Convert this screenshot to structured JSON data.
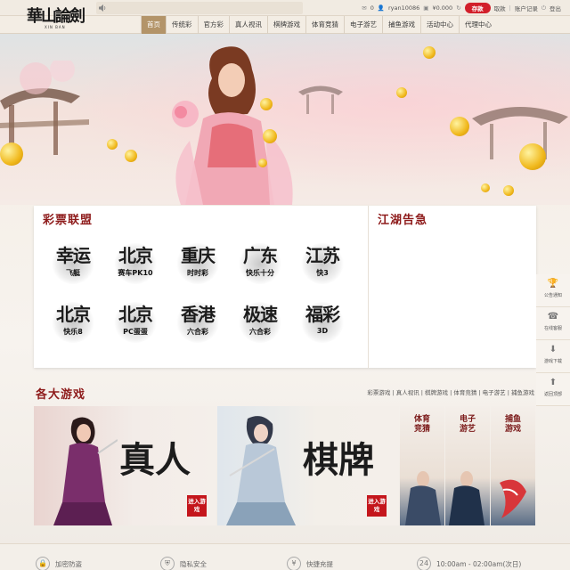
{
  "logo": {
    "text": "華山論劍",
    "sub": "XIN BAN"
  },
  "topbar": {
    "username": "ryan10086",
    "mail_count": "0",
    "balance": "¥0.000",
    "deposit": "存款",
    "withdraw": "取款",
    "account_records": "账户记录",
    "logout": "登出"
  },
  "nav": [
    "首页",
    "传统彩",
    "官方彩",
    "真人视讯",
    "棋牌游戏",
    "体育竞猜",
    "电子游艺",
    "捕鱼游戏",
    "活动中心",
    "代理中心"
  ],
  "lottery": {
    "title": "彩票联盟",
    "items": [
      {
        "big": "幸运",
        "small": "飞艇"
      },
      {
        "big": "北京",
        "small": "赛车PK10"
      },
      {
        "big": "重庆",
        "small": "时时彩"
      },
      {
        "big": "广东",
        "small": "快乐十分"
      },
      {
        "big": "江苏",
        "small": "快3"
      },
      {
        "big": "北京",
        "small": "快乐8"
      },
      {
        "big": "北京",
        "small": "PC蛋蛋"
      },
      {
        "big": "香港",
        "small": "六合彩"
      },
      {
        "big": "极速",
        "small": "六合彩"
      },
      {
        "big": "福彩",
        "small": "3D"
      }
    ]
  },
  "notice": {
    "title": "江湖告急"
  },
  "sidebar": [
    {
      "icon": "trophy-icon",
      "glyph": "🏆",
      "label": "公告通知"
    },
    {
      "icon": "headset-icon",
      "glyph": "☎",
      "label": "在线客服"
    },
    {
      "icon": "download-icon",
      "glyph": "⬇",
      "label": "游戏下载"
    },
    {
      "icon": "back-top-icon",
      "glyph": "⬆",
      "label": "返回顶部"
    }
  ],
  "games": {
    "title": "各大游戏",
    "links": "彩票游戏 | 真人视讯 | 棋牌游戏 | 体育竞猜 | 电子游艺 | 捕鱼游戏",
    "live": {
      "calli": "真人",
      "enter": "进入游戏"
    },
    "board": {
      "calli": "棋牌",
      "enter": "进入游戏"
    },
    "sports": {
      "calli": "体育竞猜"
    },
    "electronic": {
      "calli": "电子游艺"
    },
    "fishing": {
      "calli": "捕鱼游戏"
    }
  },
  "footer": {
    "anti_hijack": "加密防盗",
    "privacy": "隐私安全",
    "fast_deposit": "快捷充提",
    "hours": "10:00am - 02:00am(次日)"
  }
}
